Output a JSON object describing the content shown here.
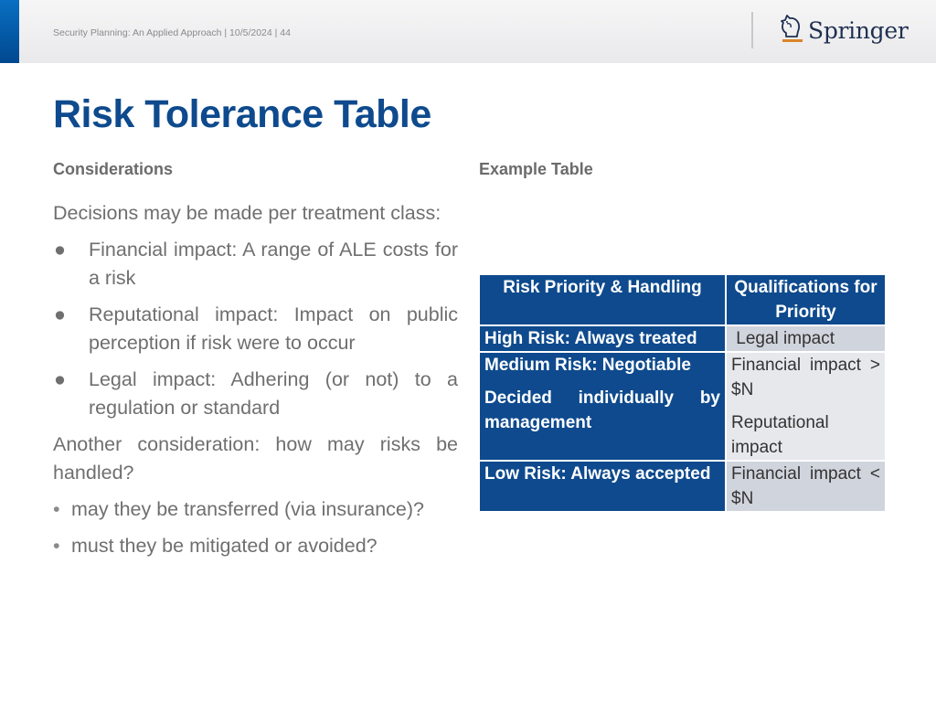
{
  "header": {
    "footer_text": "Security Planning: An Applied Approach | 10/5/2024 | 44",
    "logo_text": "Springer",
    "logo_icon": "knight-chess-icon"
  },
  "slide": {
    "title": "Risk Tolerance Table",
    "left_heading": "Considerations",
    "right_heading": "Example Table",
    "intro": "Decisions may be made per treatment class:",
    "bullets": [
      "Financial impact: A range of ALE costs for a risk",
      "Reputational impact:  Impact on public perception if risk were to occur",
      "Legal impact:  Adhering (or not) to a regulation or standard"
    ],
    "second_para": "Another consideration: how may risks be handled?",
    "sub_bullets": [
      "may they be transferred (via insurance)?",
      "must they be mitigated or avoided?"
    ]
  },
  "table": {
    "headers": [
      "Risk Priority & Handling",
      "Qualifications for Priority"
    ],
    "rows": [
      {
        "priority": "High Risk: Always treated",
        "qualification": "Legal impact"
      },
      {
        "priority": "Medium Risk: Negotiable",
        "priority_note": "Decided individually by management",
        "qualification": "Financial impact > $N",
        "qualification_note": "Reputational impact"
      },
      {
        "priority": "Low Risk: Always accepted",
        "qualification": "Financial impact < $N"
      }
    ]
  },
  "colors": {
    "brand_blue": "#0e4a8d",
    "logo_orange": "#d9862b"
  }
}
